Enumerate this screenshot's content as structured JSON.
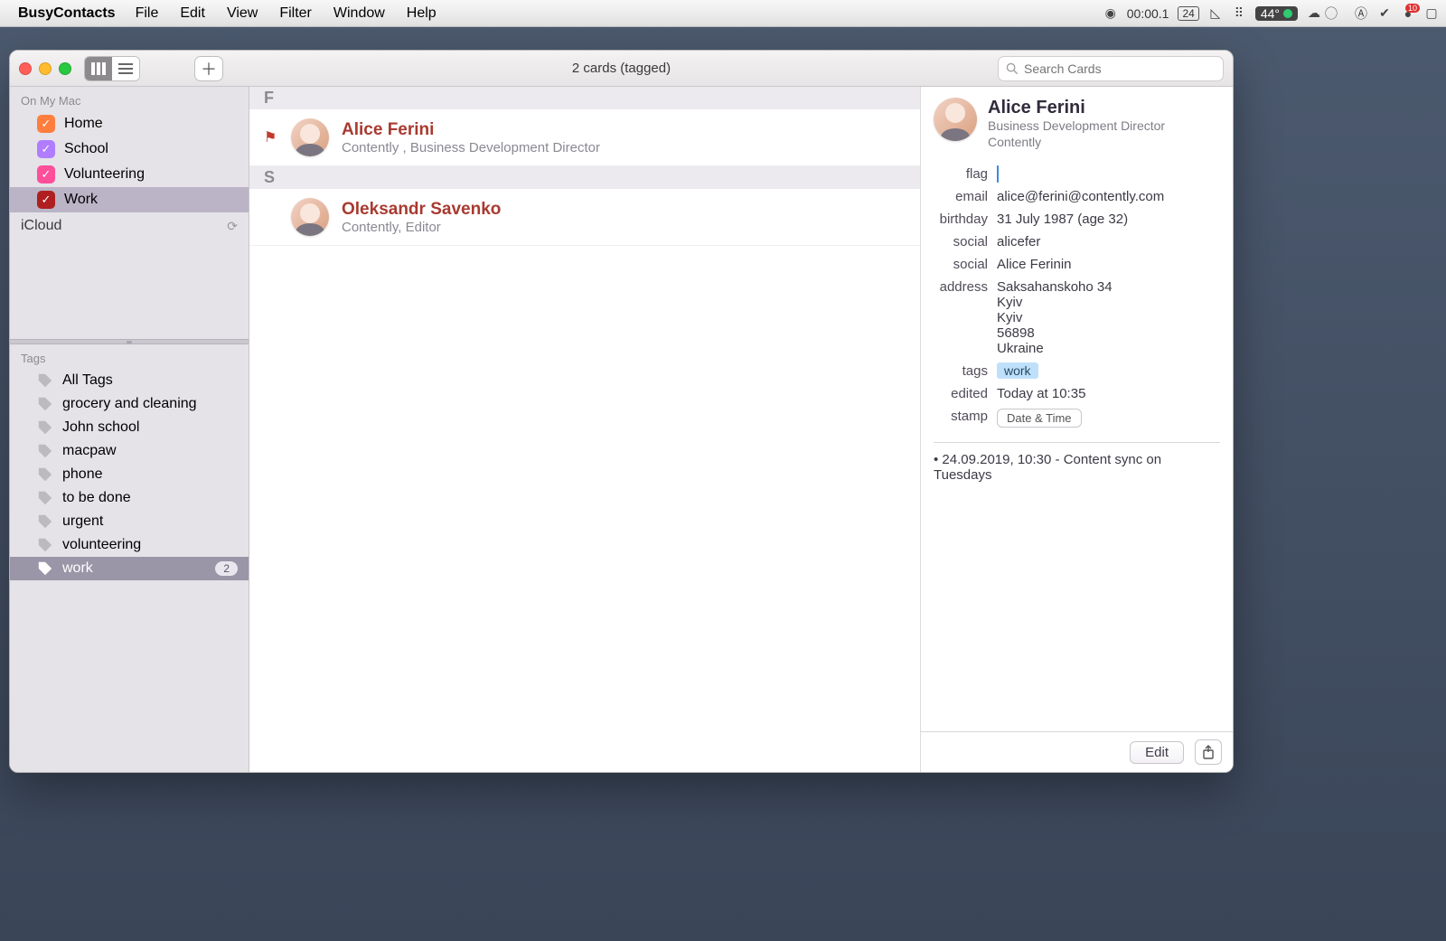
{
  "menubar": {
    "app": "BusyContacts",
    "items": [
      "File",
      "Edit",
      "View",
      "Filter",
      "Window",
      "Help"
    ],
    "timer": "00:00.1",
    "date_box": "24",
    "temp": "44°",
    "badge_count": "10"
  },
  "toolbar": {
    "title": "2 cards (tagged)",
    "search_placeholder": "Search Cards"
  },
  "sidebar": {
    "on_my_mac_label": "On My Mac",
    "groups": [
      {
        "label": "Home",
        "color": "#ff7e3e",
        "checked": true
      },
      {
        "label": "School",
        "color": "#b07dff",
        "checked": true
      },
      {
        "label": "Volunteering",
        "color": "#ff4f9a",
        "checked": true
      },
      {
        "label": "Work",
        "color": "#b01f1f",
        "checked": true,
        "selected": true
      }
    ],
    "icloud_label": "iCloud",
    "tags_label": "Tags",
    "tags": [
      {
        "label": "All Tags"
      },
      {
        "label": "grocery and cleaning"
      },
      {
        "label": "John school"
      },
      {
        "label": "macpaw"
      },
      {
        "label": "phone"
      },
      {
        "label": "to be done"
      },
      {
        "label": "urgent"
      },
      {
        "label": "volunteering"
      },
      {
        "label": "work",
        "count": "2",
        "selected": true
      }
    ]
  },
  "list": {
    "sections": [
      {
        "letter": "F",
        "cards": [
          {
            "name": "Alice Ferini",
            "subtitle": "Contently , Business Development Director",
            "flagged": true
          }
        ]
      },
      {
        "letter": "S",
        "cards": [
          {
            "name": "Oleksandr Savenko",
            "subtitle": "Contently, Editor",
            "flagged": false
          }
        ]
      }
    ]
  },
  "detail": {
    "name": "Alice Ferini",
    "role": "Business Development Director",
    "company": "Contently",
    "fields": {
      "flag": true,
      "email": "alice@ferini@contently.com",
      "birthday": "31 July 1987 (age 32)",
      "social1": "alicefer",
      "social2": "Alice Ferinin",
      "address": [
        "Saksahanskoho 34",
        "Kyiv",
        "Kyiv",
        "56898",
        "Ukraine"
      ],
      "tags": "work",
      "edited": "Today at 10:35",
      "stamp_label": "Date & Time"
    },
    "labels": {
      "flag": "flag",
      "email": "email",
      "birthday": "birthday",
      "social": "social",
      "address": "address",
      "tags": "tags",
      "edited": "edited",
      "stamp": "stamp"
    },
    "note": "• 24.09.2019, 10:30 - Content sync on Tuesdays",
    "edit_label": "Edit"
  }
}
